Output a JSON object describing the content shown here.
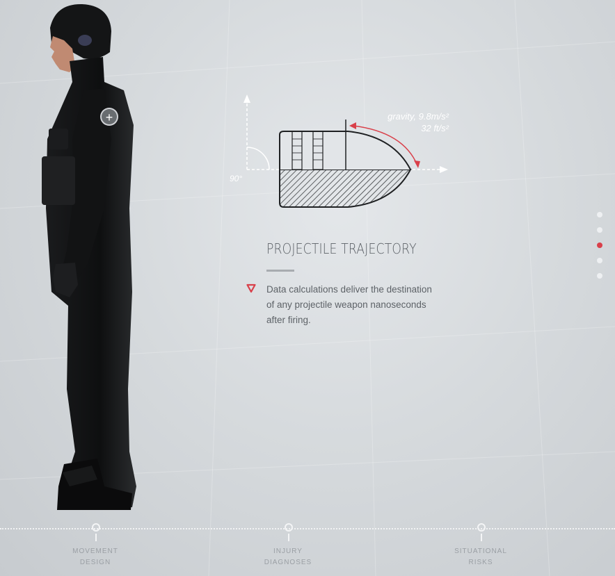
{
  "diagram": {
    "angle_label": "90°",
    "gravity_line1": "gravity, 9.8m/s²",
    "gravity_line2": "32 ft/s²"
  },
  "feature": {
    "title": "PROJECTILE TRAJECTORY",
    "description": "Data calculations deliver the destination of any projectile weapon nanoseconds after firing."
  },
  "pager": {
    "count": 5,
    "active_index": 2,
    "active_color": "#d9404a"
  },
  "timeline": {
    "items": [
      {
        "line1": "MOVEMENT",
        "line2": "DESIGN"
      },
      {
        "line1": "INJURY",
        "line2": "DIAGNOSES"
      },
      {
        "line1": "SITUATIONAL",
        "line2": "RISKS"
      }
    ]
  },
  "hotspot": {
    "symbol": "+"
  },
  "colors": {
    "accent": "#d9404a",
    "text": "#5d6267"
  }
}
